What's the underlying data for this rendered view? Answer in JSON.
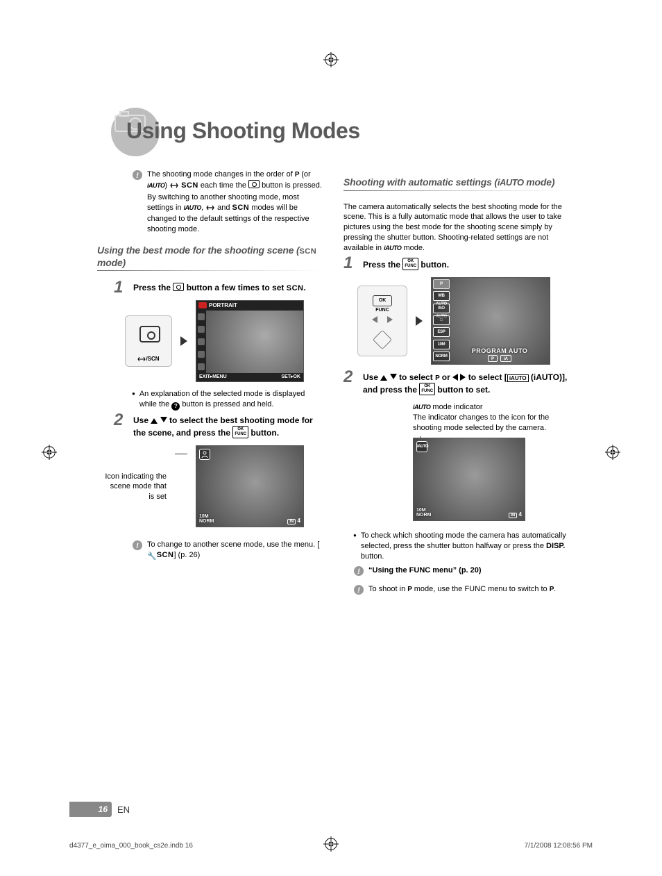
{
  "chapter_title": "Using Shooting Modes",
  "intro_note": {
    "l1a": "The shooting mode changes in the order of ",
    "P": "P",
    "l1b": " (or ",
    "iauto": "iAUTO",
    "l1c": ") ",
    "scn": "SCN",
    "l1d": " each time the ",
    "l2a": " button is pressed. By switching to another shooting mode, most settings in ",
    "l2b": ", ",
    "l2c": " and ",
    "l2d": " modes will be changed to the default settings of the respective shooting mode."
  },
  "left": {
    "section_title_a": "Using the best mode for the shooting scene (",
    "section_title_b": " mode)",
    "step1_a": "Press the ",
    "step1_b": " button a few times to set ",
    "step1_c": ".",
    "dial_label": "/SCN",
    "lcd_top": "PORTRAIT",
    "lcd_foot_l": "EXIT▸MENU",
    "lcd_foot_r": "SET▸OK",
    "bullet1_a": "An explanation of the selected mode is displayed while the ",
    "bullet1_b": " button is pressed and held.",
    "step2_a": "Use ",
    "step2_b": " to select the best shooting mode for the scene, and press the ",
    "step2_c": " button.",
    "caption": "Icon indicating the scene mode that is set",
    "lcd2_in": "IN",
    "lcd2_count": "4",
    "lcd2_bl1": "10M",
    "lcd2_bl2": "NORM",
    "tip1_a": "To change to another scene mode, use the menu. [",
    "tip1_b": "] (p. 26)"
  },
  "right": {
    "section_title_a": "Shooting with automatic settings (",
    "section_title_b": " mode)",
    "para_a": "The camera automatically selects the best shooting mode for the scene. This is a fully automatic mode that allows the user to take pictures using the best mode for the shooting scene simply by pressing the shutter button. Shooting-related settings are not available in ",
    "para_b": " mode.",
    "step1_a": "Press the ",
    "step1_b": " button.",
    "dial_ok": "OK\nFUNC",
    "chips": [
      "P",
      "WB AUTO",
      "ISO AUTO",
      "□",
      "ESP",
      "10M",
      "NORM"
    ],
    "lcd3_caption": "PROGRAM AUTO",
    "lcd3_foot_p": "P",
    "step2_a": "Use ",
    "step2_b": " to select ",
    "step2_c": " or ",
    "step2_d": " to select [",
    "step2_e": " (iAUTO)], and press the ",
    "step2_f": " button to set.",
    "ind_title": " mode indicator",
    "ind_body": "The indicator changes to the icon for the shooting mode selected by the camera.",
    "lcd4_bl1": "10M",
    "lcd4_bl2": "NORM",
    "lcd4_in": "IN",
    "lcd4_count": "4",
    "bullet2_a": "To check which shooting mode the camera has automatically selected, press the shutter button halfway or press the ",
    "bullet2_b": " button.",
    "tip2": "“Using the FUNC menu” (p. 20)",
    "tip3_a": "To shoot in ",
    "tip3_b": " mode, use the FUNC menu to switch to ",
    "tip3_c": "."
  },
  "footer": {
    "page": "16",
    "lang": "EN"
  },
  "print": {
    "left": "d4377_e_oima_000_book_cs2e.indb   16",
    "right": "7/1/2008   12:08:56 PM"
  }
}
